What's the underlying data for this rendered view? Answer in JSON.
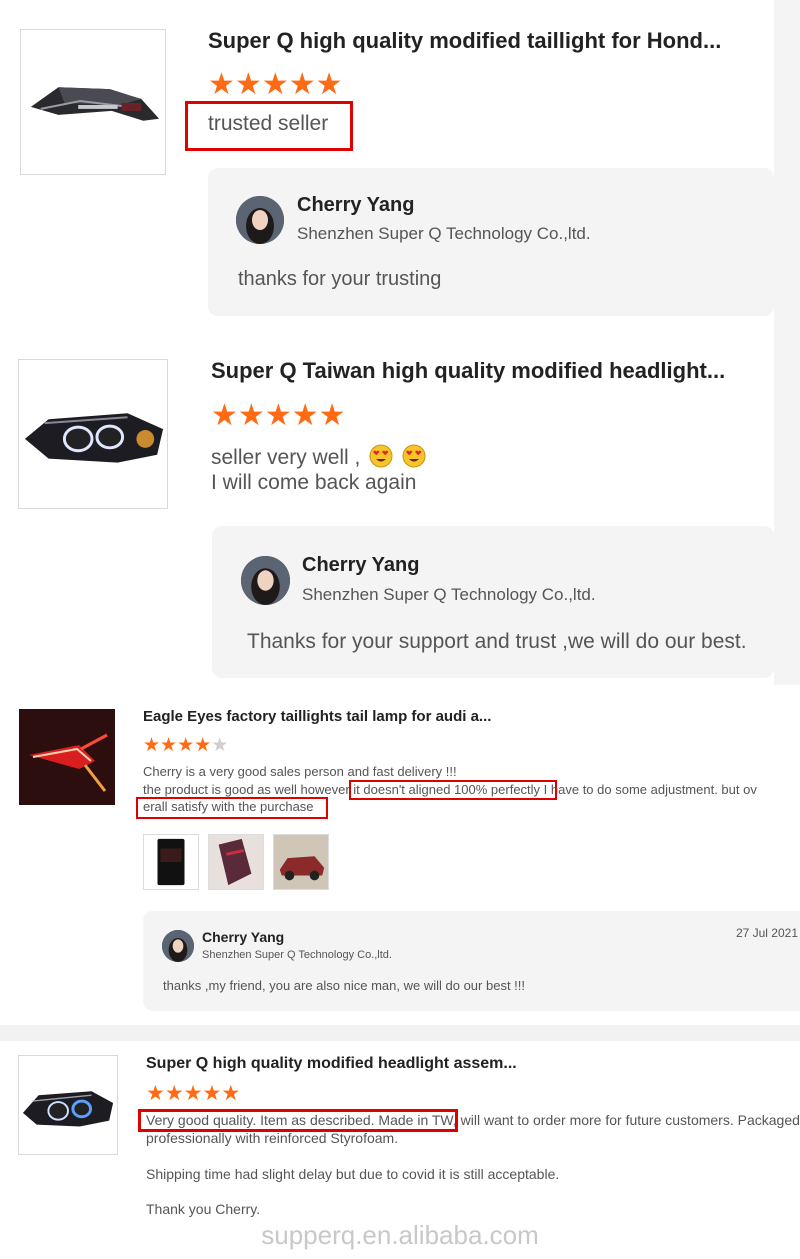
{
  "watermark": "supperq.en.alibaba.com",
  "colors": {
    "star": "#ff6a14",
    "star_empty": "#cfcfcf",
    "highlight": "#e00000",
    "reply_bg": "#f4f4f4"
  },
  "reviews": [
    {
      "product_title": "Super Q high quality modified taillight for Hond...",
      "rating": 5,
      "comment": "trusted seller",
      "reply": {
        "name": "Cherry Yang",
        "company": "Shenzhen Super Q Technology Co.,ltd.",
        "text": "thanks for your trusting"
      }
    },
    {
      "product_title": "Super Q Taiwan high quality modified headlight...",
      "rating": 5,
      "comment_line1": "seller very well ,",
      "comment_emojis": [
        "heart-eyes-emoji",
        "heart-eyes-emoji"
      ],
      "comment_line2": "I will come back again",
      "reply": {
        "name": "Cherry Yang",
        "company": "Shenzhen Super Q Technology Co.,ltd.",
        "text": "Thanks for your support and trust ,we will do our best."
      }
    },
    {
      "product_title": "Eagle Eyes factory taillights tail lamp for audi a...",
      "rating": 4,
      "comment_line1": "Cherry is a very good sales person and fast delivery !!!",
      "comment_line2": "the product is good as well however it doesn't aligned 100% perfectly I have to do some adjustment. but ov",
      "comment_line3": "erall satisfy with the purchase",
      "photos": [
        "review-photo-phone",
        "review-photo-taillight",
        "review-photo-car"
      ],
      "reply": {
        "name": "Cherry Yang",
        "company": "Shenzhen Super Q Technology Co.,ltd.",
        "date": "27 Jul 2021",
        "text": "thanks ,my friend, you are also nice man, we will do our best !!!"
      }
    },
    {
      "product_title": "Super Q high quality modified headlight assem...",
      "rating": 5,
      "comment_line1": "Very good quality. Item as described. Made in TW, will want to order more for future customers. Packaged",
      "comment_line2": "professionally with reinforced Styrofoam.",
      "comment_line3": "Shipping time had slight delay but due to covid it is still acceptable.",
      "comment_line4": "Thank you Cherry."
    }
  ]
}
